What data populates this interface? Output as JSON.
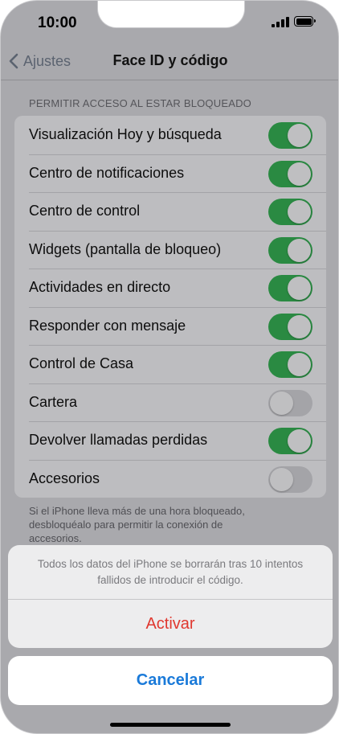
{
  "status_bar": {
    "time": "10:00"
  },
  "nav": {
    "back_label": "Ajustes",
    "title": "Face ID y código"
  },
  "section": {
    "header": "PERMITIR ACCESO AL ESTAR BLOQUEADO",
    "rows": [
      {
        "label": "Visualización Hoy y búsqueda",
        "on": true
      },
      {
        "label": "Centro de notificaciones",
        "on": true
      },
      {
        "label": "Centro de control",
        "on": true
      },
      {
        "label": "Widgets (pantalla de bloqueo)",
        "on": true
      },
      {
        "label": "Actividades en directo",
        "on": true
      },
      {
        "label": "Responder con mensaje",
        "on": true
      },
      {
        "label": "Control de Casa",
        "on": true
      },
      {
        "label": "Cartera",
        "on": false
      },
      {
        "label": "Devolver llamadas perdidas",
        "on": true
      },
      {
        "label": "Accesorios",
        "on": false
      }
    ],
    "footer_lines": [
      "Si el iPhone lleva más de una hora bloqueado,",
      "desbloquéalo para permitir la conexión de",
      "accesorios."
    ]
  },
  "action_sheet": {
    "message_lines": [
      "Todos los datos del iPhone se borrarán tras 10 intentos",
      "fallidos de introducir el código."
    ],
    "activate_label": "Activar",
    "cancel_label": "Cancelar"
  },
  "colors": {
    "toggle_on": "#2a8a42",
    "toggle_off": "#a4a4a8",
    "destructive": "#e0382f",
    "accent": "#1a7ad9"
  }
}
